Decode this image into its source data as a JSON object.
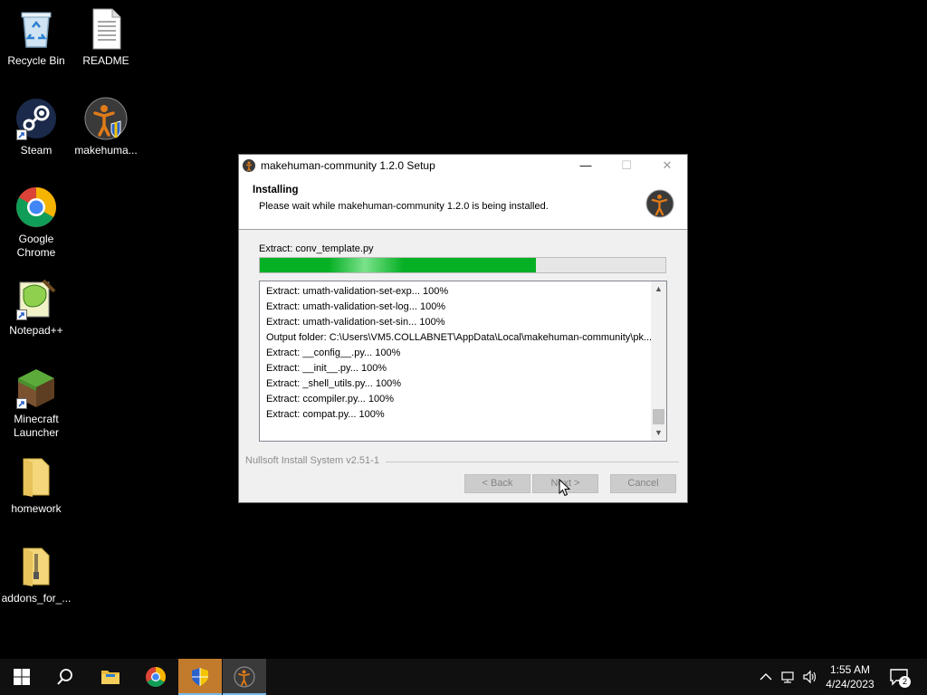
{
  "desktop": {
    "icons": [
      {
        "label": "Recycle Bin"
      },
      {
        "label": "README"
      },
      {
        "label": "Steam"
      },
      {
        "label": "makehuma..."
      },
      {
        "label": "Google Chrome"
      },
      {
        "label": "Notepad++"
      },
      {
        "label": "Minecraft Launcher"
      },
      {
        "label": "homework"
      },
      {
        "label": "addons_for_..."
      }
    ]
  },
  "window": {
    "title": "makehuman-community 1.2.0 Setup",
    "header": {
      "title": "Installing",
      "subtitle": "Please wait while makehuman-community 1.2.0 is being installed."
    },
    "status": "Extract: conv_template.py",
    "progress_percent": 68,
    "log": [
      "Extract: umath-validation-set-exp... 100%",
      "Extract: umath-validation-set-log... 100%",
      "Extract: umath-validation-set-sin... 100%",
      "Output folder: C:\\Users\\VM5.COLLABNET\\AppData\\Local\\makehuman-community\\pk...",
      "Extract: __config__.py... 100%",
      "Extract: __init__.py... 100%",
      "Extract: _shell_utils.py... 100%",
      "Extract: ccompiler.py... 100%",
      "Extract: compat.py... 100%"
    ],
    "branding": "Nullsoft Install System v2.51-1",
    "buttons": {
      "back": "< Back",
      "next": "Next >",
      "cancel": "Cancel"
    }
  },
  "taskbar": {
    "time": "1:55 AM",
    "date": "4/24/2023",
    "notification_count": "2"
  },
  "colors": {
    "progress": "#06b025",
    "setup_taskbar": "#c27a2c"
  }
}
